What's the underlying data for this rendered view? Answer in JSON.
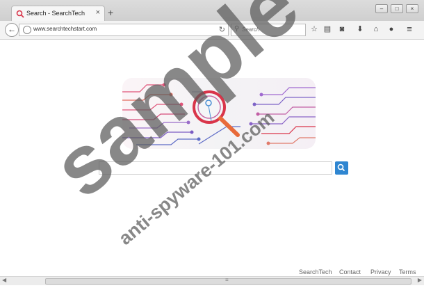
{
  "tab": {
    "title": "Search - SearchTech",
    "close_glyph": "×",
    "new_tab_glyph": "+"
  },
  "window_controls": {
    "minimize": "–",
    "maximize": "□",
    "close": "×"
  },
  "navbar": {
    "url": "www.searchtechstart.com",
    "search_placeholder": "Search"
  },
  "toolbar_icons": [
    "star-icon",
    "clipboard-icon",
    "pocket-icon",
    "download-icon",
    "home-icon",
    "chat-icon",
    "menu-icon"
  ],
  "page": {
    "search_placeholder": "",
    "search_icon": "search-icon"
  },
  "footer": {
    "links": [
      "SearchTech",
      "Contact",
      "Privacy",
      "Terms"
    ]
  },
  "watermark": {
    "main": "sample",
    "url": "anti-spyware-101.com"
  },
  "colors": {
    "accent": "#2f86d1",
    "logo_magnifier": "#d9354a",
    "circuit_purple": "#8a63c7"
  }
}
